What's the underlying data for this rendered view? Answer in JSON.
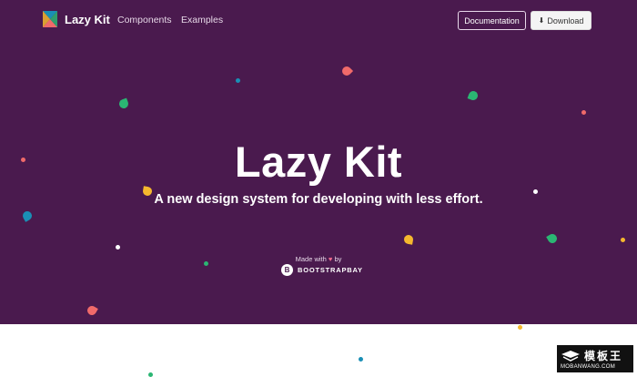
{
  "navbar": {
    "brand": "Lazy Kit",
    "links": [
      "Components",
      "Examples"
    ],
    "documentation_label": "Documentation",
    "download_label": "Download",
    "download_icon": "download-icon"
  },
  "hero": {
    "title": "Lazy Kit",
    "subtitle": "A new design system for developing with less effort.",
    "made_with_prefix": "Made with",
    "made_with_suffix": "by",
    "heart_icon": "heart-icon",
    "credit": "BOOTSTRAPBAY"
  },
  "watermark": {
    "text": "模板王",
    "url": "MOBANWANG.COM"
  },
  "colors": {
    "hero_background": "#4a1a4e",
    "confetti": [
      "#f06a6a",
      "#2bb673",
      "#f5b82e",
      "#1a8fb5",
      "#ffffff"
    ]
  }
}
